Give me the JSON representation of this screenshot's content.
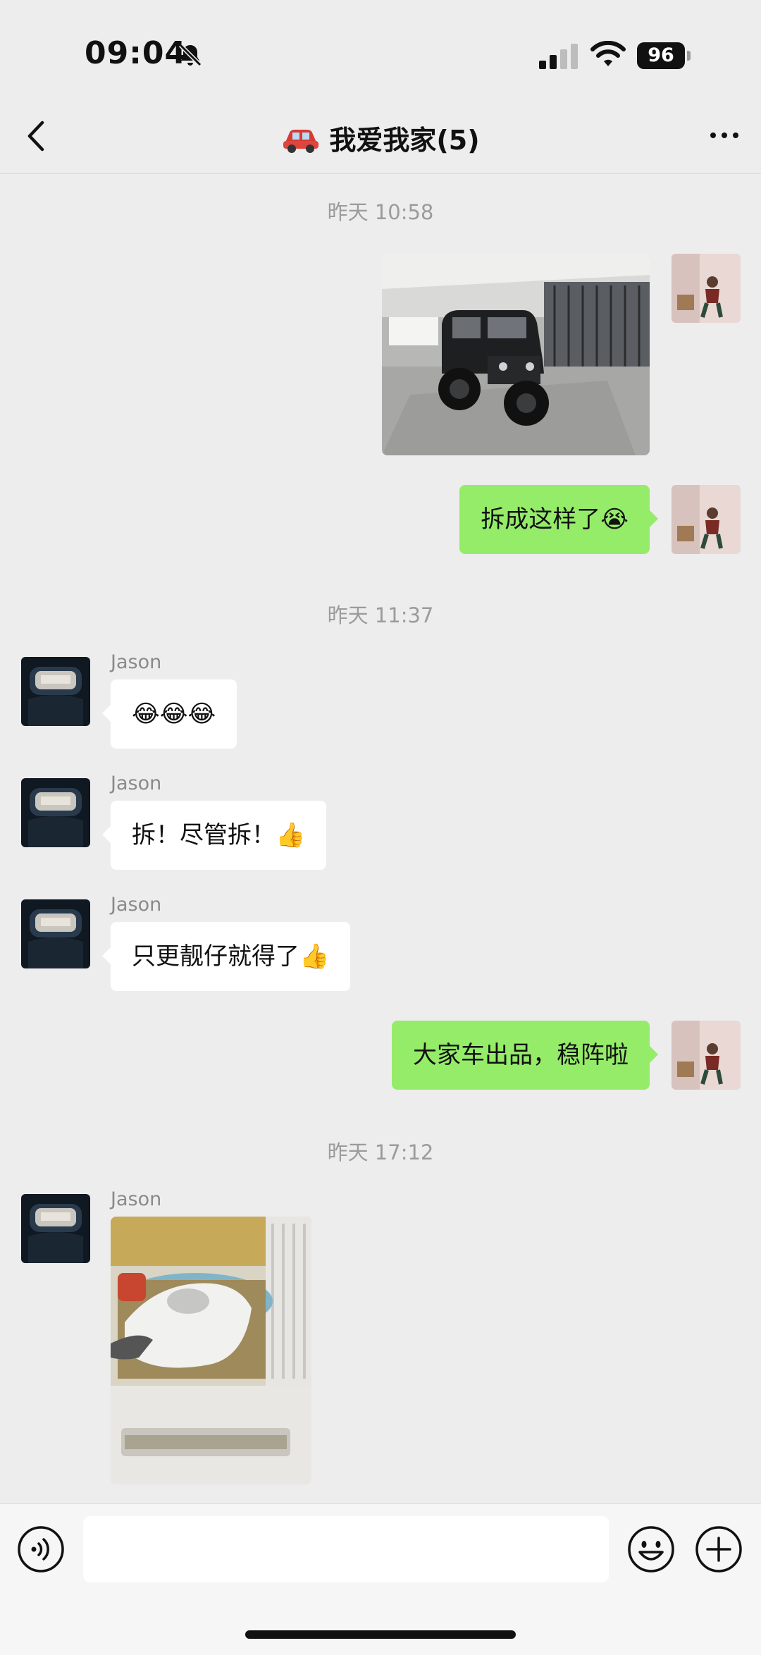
{
  "status_bar": {
    "time": "09:04",
    "battery": "96",
    "icons": [
      "bell-slash-icon",
      "cellular-signal-icon",
      "wifi-icon",
      "battery-icon"
    ]
  },
  "nav": {
    "title": "我爱我家(5)",
    "icons": [
      "back-chevron-icon",
      "red-car-icon",
      "more-dots-icon"
    ]
  },
  "chat": {
    "timestamps": [
      "昨天 10:58",
      "昨天 11:37",
      "昨天 17:12"
    ],
    "messages": [
      {
        "type": "image",
        "from": "me",
        "content": "black Jeep in showroom"
      },
      {
        "type": "text",
        "from": "me",
        "text": "拆成这样了",
        "emoji": "😭"
      },
      {
        "type": "text",
        "from": "Jason",
        "text": "",
        "emoji": "😂😂😂"
      },
      {
        "type": "text",
        "from": "Jason",
        "text": "拆！尽管拆！",
        "emoji": "👍"
      },
      {
        "type": "text",
        "from": "Jason",
        "text": "只更靓仔就得了",
        "emoji": "👍"
      },
      {
        "type": "text",
        "from": "me",
        "text": "大家车出品，稳阵啦"
      },
      {
        "type": "image",
        "from": "Jason",
        "content": "cat sleeping in pet bed"
      }
    ],
    "sender_name": "Jason"
  },
  "input_bar": {
    "value": "",
    "icons": [
      "voice-icon",
      "emoji-face-icon",
      "plus-icon"
    ]
  },
  "colors": {
    "background": "#ededed",
    "outgoing_bubble": "#95ec69",
    "incoming_bubble": "#ffffff",
    "timestamp_text": "#9b9b9b"
  }
}
